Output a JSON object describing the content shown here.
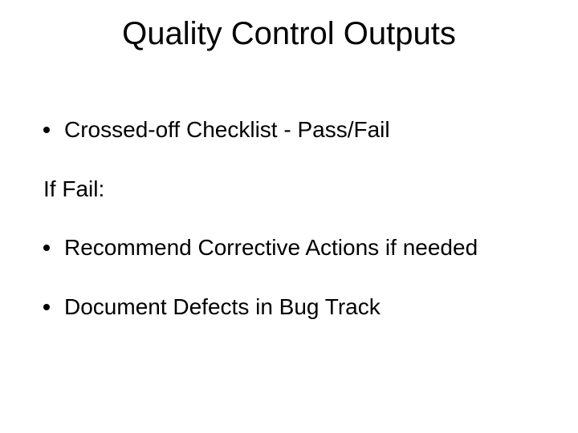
{
  "title": "Quality Control Outputs",
  "bullets": {
    "b1": "Crossed-off Checklist - Pass/Fail",
    "b2": "Recommend Corrective Actions if needed",
    "b3": "Document Defects in Bug Track"
  },
  "if_fail": "If Fail:"
}
